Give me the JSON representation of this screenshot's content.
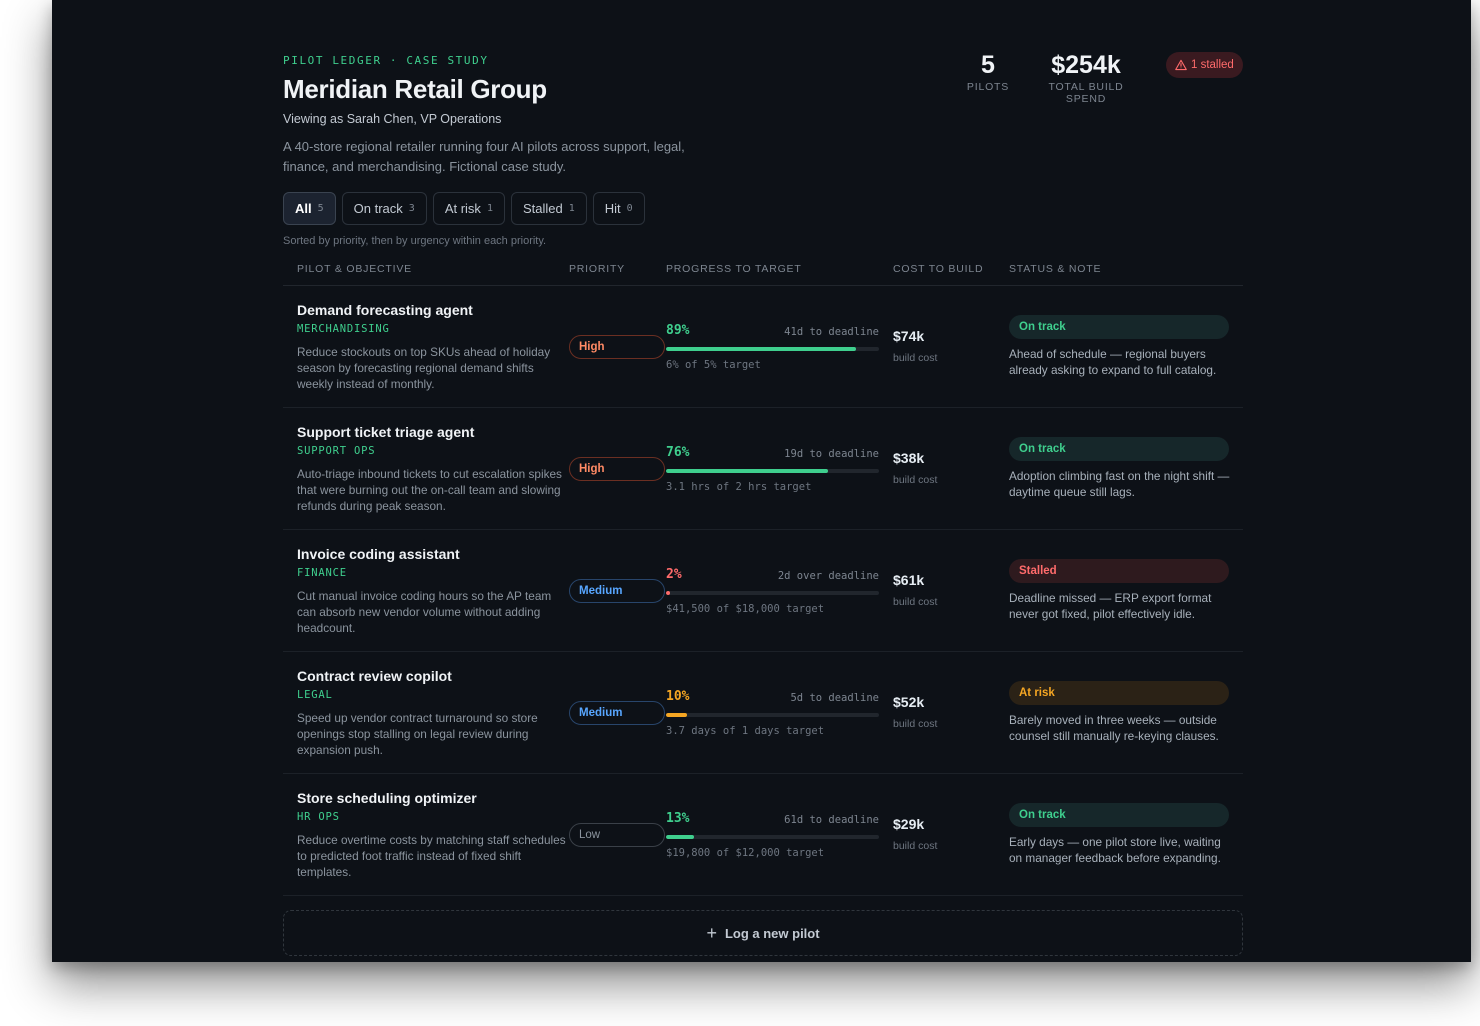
{
  "header": {
    "eyebrow": "PILOT LEDGER · CASE STUDY",
    "title": "Meridian Retail Group",
    "viewing_as": "Viewing as Sarah Chen, VP Operations",
    "description": "A 40-store regional retailer running four AI pilots across support, legal, finance, and merchandising. Fictional case study."
  },
  "stats": {
    "pilots_value": "5",
    "pilots_label": "PILOTS",
    "spend_value": "$254k",
    "spend_label": "TOTAL BUILD SPEND",
    "stalled_badge": "1 stalled",
    "stalled_icon": "warning-triangle-icon"
  },
  "filters": [
    {
      "label": "All",
      "count": "5",
      "active": true
    },
    {
      "label": "On track",
      "count": "3",
      "active": false
    },
    {
      "label": "At risk",
      "count": "1",
      "active": false
    },
    {
      "label": "Stalled",
      "count": "1",
      "active": false
    },
    {
      "label": "Hit",
      "count": "0",
      "active": false
    }
  ],
  "sort_note": "Sorted by priority, then by urgency within each priority.",
  "columns": {
    "pilot": "PILOT & OBJECTIVE",
    "priority": "PRIORITY",
    "progress": "PROGRESS TO TARGET",
    "cost": "COST TO BUILD",
    "status": "STATUS & NOTE"
  },
  "colors": {
    "green": "#3fcf8e",
    "red": "#ff6b6b",
    "orange": "#f5a623"
  },
  "pilots": [
    {
      "name": "Demand forecasting agent",
      "dept": "MERCHANDISING",
      "desc": "Reduce stockouts on top SKUs ahead of holiday season by forecasting regional demand shifts weekly instead of monthly.",
      "priority": "High",
      "priority_level": "high",
      "pct": "89%",
      "progress": 0.89,
      "progress_color": "#3fcf8e",
      "deadline": "41d to deadline",
      "target": "6% of 5% target",
      "cost": "$74k",
      "cost_label": "build cost",
      "status": "On track",
      "status_level": "ontrack",
      "note": "Ahead of schedule — regional buyers already asking to expand to full catalog."
    },
    {
      "name": "Support ticket triage agent",
      "dept": "SUPPORT OPS",
      "desc": "Auto-triage inbound tickets to cut escalation spikes that were burning out the on-call team and slowing refunds during peak season.",
      "priority": "High",
      "priority_level": "high",
      "pct": "76%",
      "progress": 0.76,
      "progress_color": "#3fcf8e",
      "deadline": "19d to deadline",
      "target": "3.1 hrs of 2 hrs target",
      "cost": "$38k",
      "cost_label": "build cost",
      "status": "On track",
      "status_level": "ontrack",
      "note": "Adoption climbing fast on the night shift — daytime queue still lags."
    },
    {
      "name": "Invoice coding assistant",
      "dept": "FINANCE",
      "desc": "Cut manual invoice coding hours so the AP team can absorb new vendor volume without adding headcount.",
      "priority": "Medium",
      "priority_level": "medium",
      "pct": "2%",
      "progress": 0.02,
      "progress_color": "#ff6b6b",
      "deadline": "2d over deadline",
      "target": "$41,500 of $18,000 target",
      "cost": "$61k",
      "cost_label": "build cost",
      "status": "Stalled",
      "status_level": "stalled",
      "note": "Deadline missed — ERP export format never got fixed, pilot effectively idle."
    },
    {
      "name": "Contract review copilot",
      "dept": "LEGAL",
      "desc": "Speed up vendor contract turnaround so store openings stop stalling on legal review during expansion push.",
      "priority": "Medium",
      "priority_level": "medium",
      "pct": "10%",
      "progress": 0.1,
      "progress_color": "#f5a623",
      "deadline": "5d to deadline",
      "target": "3.7 days of 1 days target",
      "cost": "$52k",
      "cost_label": "build cost",
      "status": "At risk",
      "status_level": "atrisk",
      "note": "Barely moved in three weeks — outside counsel still manually re-keying clauses."
    },
    {
      "name": "Store scheduling optimizer",
      "dept": "HR OPS",
      "desc": "Reduce overtime costs by matching staff schedules to predicted foot traffic instead of fixed shift templates.",
      "priority": "Low",
      "priority_level": "low",
      "pct": "13%",
      "progress": 0.13,
      "progress_color": "#3fcf8e",
      "deadline": "61d to deadline",
      "target": "$19,800 of $12,000 target",
      "cost": "$29k",
      "cost_label": "build cost",
      "status": "On track",
      "status_level": "ontrack",
      "note": "Early days — one pilot store live, waiting on manager feedback before expanding."
    }
  ],
  "add_button": {
    "label": "Log a new pilot",
    "icon": "plus-icon"
  }
}
